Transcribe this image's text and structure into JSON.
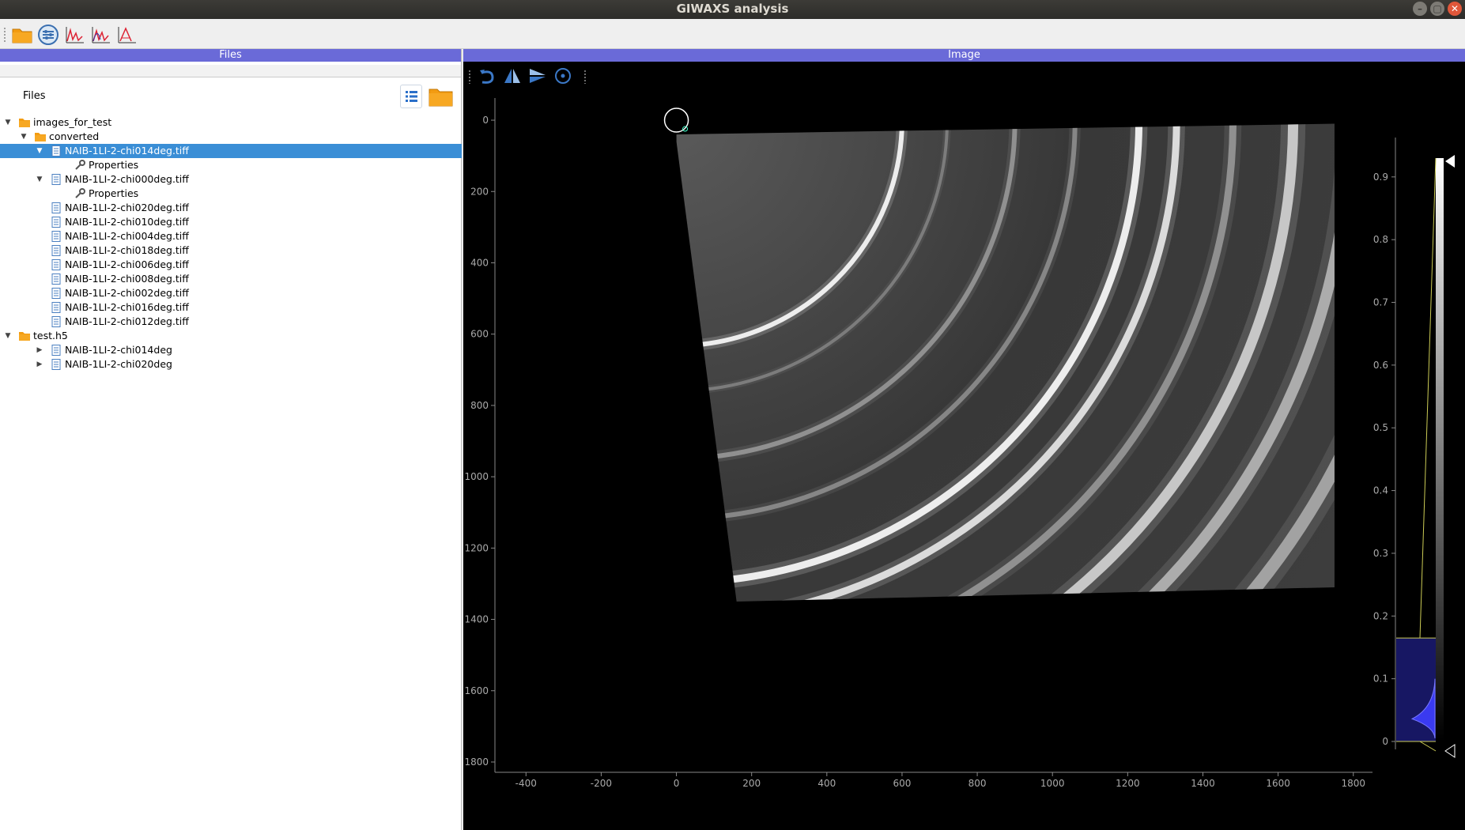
{
  "window": {
    "title": "GIWAXS analysis",
    "min": "–",
    "max": "▢",
    "close": "✕"
  },
  "toolbar": {
    "items": [
      "open-folder",
      "settings",
      "peaks-1",
      "peaks-2",
      "fit"
    ]
  },
  "files_panel": {
    "header": "Files",
    "label": "Files",
    "tree": [
      {
        "level": 0,
        "expanded": true,
        "icon": "folder",
        "label": "images_for_test"
      },
      {
        "level": 1,
        "expanded": true,
        "icon": "folder",
        "label": "converted"
      },
      {
        "level": 2,
        "expanded": true,
        "icon": "file",
        "label": "NAIB-1LI-2-chi014deg.tiff",
        "selected": true
      },
      {
        "level": 3,
        "icon": "wrench",
        "label": "Properties"
      },
      {
        "level": 2,
        "expanded": true,
        "icon": "file",
        "label": "NAIB-1LI-2-chi000deg.tiff"
      },
      {
        "level": 3,
        "icon": "wrench",
        "label": "Properties"
      },
      {
        "level": 2,
        "icon": "file",
        "label": "NAIB-1LI-2-chi020deg.tiff"
      },
      {
        "level": 2,
        "icon": "file",
        "label": "NAIB-1LI-2-chi010deg.tiff"
      },
      {
        "level": 2,
        "icon": "file",
        "label": "NAIB-1LI-2-chi004deg.tiff"
      },
      {
        "level": 2,
        "icon": "file",
        "label": "NAIB-1LI-2-chi018deg.tiff"
      },
      {
        "level": 2,
        "icon": "file",
        "label": "NAIB-1LI-2-chi006deg.tiff"
      },
      {
        "level": 2,
        "icon": "file",
        "label": "NAIB-1LI-2-chi008deg.tiff"
      },
      {
        "level": 2,
        "icon": "file",
        "label": "NAIB-1LI-2-chi002deg.tiff"
      },
      {
        "level": 2,
        "icon": "file",
        "label": "NAIB-1LI-2-chi016deg.tiff"
      },
      {
        "level": 2,
        "icon": "file",
        "label": "NAIB-1LI-2-chi012deg.tiff"
      },
      {
        "level": 0,
        "expanded": true,
        "icon": "folder",
        "label": "test.h5"
      },
      {
        "level": 2,
        "expanded": false,
        "icon": "file",
        "label": "NAIB-1LI-2-chi014deg"
      },
      {
        "level": 2,
        "expanded": false,
        "icon": "file",
        "label": "NAIB-1LI-2-chi020deg"
      }
    ]
  },
  "image_panel": {
    "header": "Image",
    "tools": [
      "rotate-icon",
      "flip-horizontal-icon",
      "flip-vertical-icon",
      "beam-center-icon"
    ],
    "x_ticks": [
      "-400",
      "-200",
      "0",
      "200",
      "400",
      "600",
      "800",
      "1000",
      "1200",
      "1400",
      "1600",
      "1800"
    ],
    "y_ticks": [
      "0",
      "200",
      "400",
      "600",
      "800",
      "1000",
      "1200",
      "1400",
      "1600",
      "1800"
    ],
    "x_range": [
      -470,
      1830
    ],
    "y_range": [
      -40,
      1820
    ],
    "colorbar": {
      "ticks": [
        "0.9",
        "0.8",
        "0.7",
        "0.6",
        "0.5",
        "0.4",
        "0.3",
        "0.2",
        "0.1",
        "0"
      ],
      "range": [
        0,
        0.93
      ],
      "level_low": 0,
      "level_high": 0.165
    },
    "beam_center": {
      "x": 0,
      "y": 0
    },
    "rings": [
      {
        "radius": 600,
        "intensity": 0.95,
        "width": 6
      },
      {
        "radius": 720,
        "intensity": 0.35,
        "width": 4
      },
      {
        "radius": 900,
        "intensity": 0.45,
        "width": 6
      },
      {
        "radius": 1060,
        "intensity": 0.4,
        "width": 6
      },
      {
        "radius": 1230,
        "intensity": 0.95,
        "width": 9
      },
      {
        "radius": 1330,
        "intensity": 0.85,
        "width": 9
      },
      {
        "radius": 1480,
        "intensity": 0.45,
        "width": 9
      },
      {
        "radius": 1640,
        "intensity": 0.75,
        "width": 13
      },
      {
        "radius": 1790,
        "intensity": 0.6,
        "width": 14
      },
      {
        "radius": 1980,
        "intensity": 0.55,
        "width": 16
      }
    ]
  }
}
